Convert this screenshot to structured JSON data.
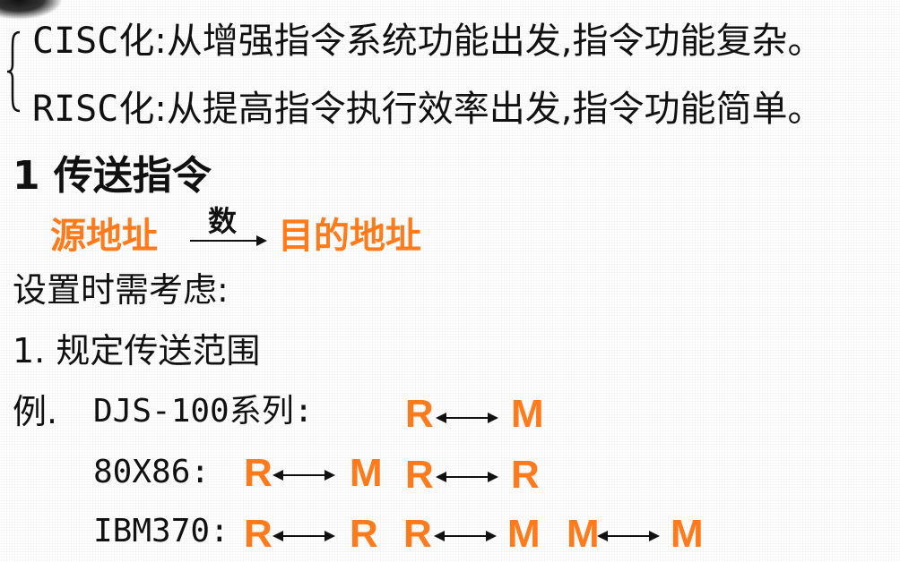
{
  "bullets": [
    {
      "term": "CISC化",
      "sep": ":",
      "desc": "从增强指令系统功能出发,指令功能复杂。"
    },
    {
      "term": "RISC化",
      "sep": ":",
      "desc": "从提高指令执行效率出发,指令功能简单。"
    }
  ],
  "section": {
    "title": "1 传送指令"
  },
  "transfer": {
    "source": "源地址",
    "arrow_label": "数",
    "destination": "目的地址"
  },
  "considerations": {
    "heading": "设置时需考虑:",
    "item1": "1. 规定传送范围"
  },
  "examples": {
    "example_label": "例.",
    "djs": {
      "name": "DJS-100系列:",
      "pairs": [
        [
          "R",
          "M"
        ]
      ]
    },
    "x86": {
      "name": "80X86:",
      "pairs": [
        [
          "R",
          "M"
        ],
        [
          "R",
          "R"
        ]
      ]
    },
    "ibm": {
      "name": "IBM370:",
      "pairs": [
        [
          "R",
          "R"
        ],
        [
          "R",
          "M"
        ],
        [
          "M",
          "M"
        ]
      ]
    }
  }
}
